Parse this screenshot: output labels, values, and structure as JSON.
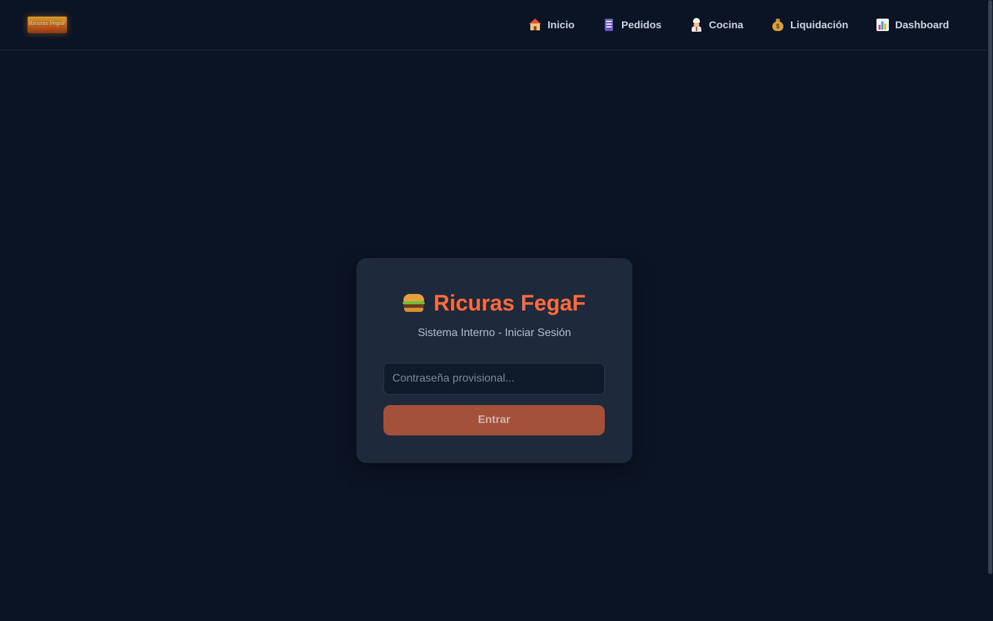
{
  "brand": {
    "logo_text": "Ricuras FegaF",
    "logo_icon": "brand-logo"
  },
  "nav": {
    "items": [
      {
        "label": "Inicio",
        "icon": "house-icon"
      },
      {
        "label": "Pedidos",
        "icon": "memo-icon"
      },
      {
        "label": "Cocina",
        "icon": "chef-icon"
      },
      {
        "label": "Liquidación",
        "icon": "money-bag-icon"
      },
      {
        "label": "Dashboard",
        "icon": "bar-chart-icon"
      }
    ]
  },
  "login": {
    "icon": "burger-icon",
    "title": "Ricuras FegaF",
    "subtitle": "Sistema Interno - Iniciar Sesión",
    "password_placeholder": "Contraseña provisional...",
    "password_value": "",
    "submit_label": "Entrar"
  },
  "colors": {
    "background": "#0b1424",
    "card": "#1e293b",
    "accent": "#ff6b3d",
    "button": "#a3513a"
  }
}
